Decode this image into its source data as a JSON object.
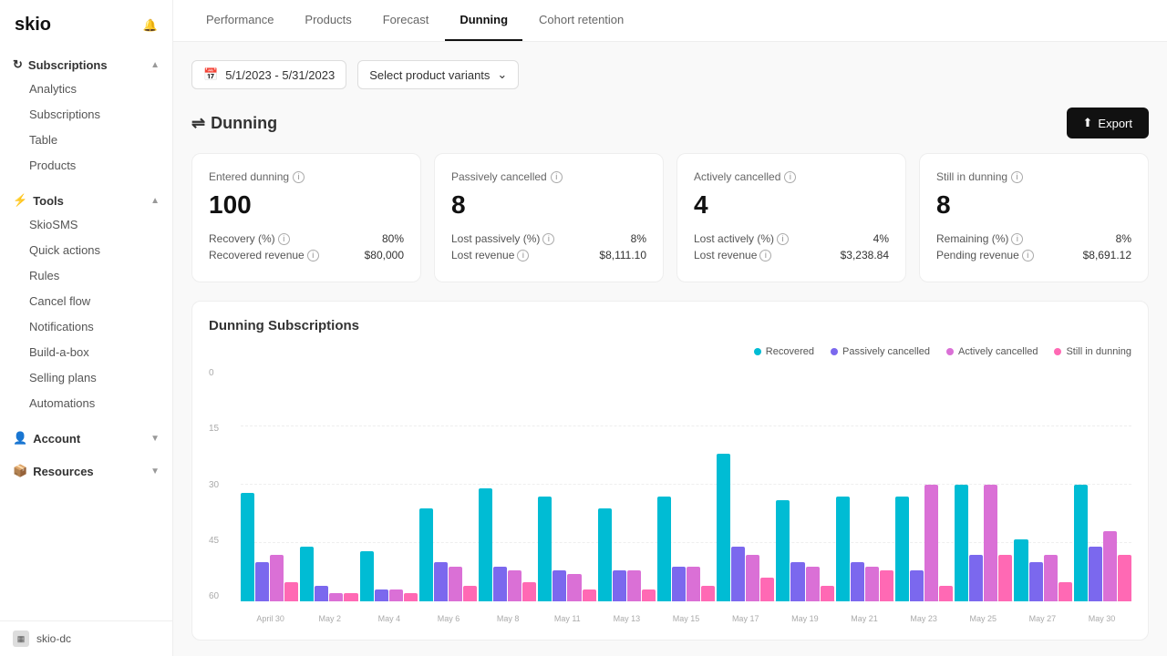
{
  "sidebar": {
    "logo": "skio",
    "sections": [
      {
        "title": "Subscriptions",
        "icon": "↻",
        "expanded": true,
        "items": [
          {
            "label": "Analytics",
            "active": false
          },
          {
            "label": "Subscriptions",
            "active": false
          },
          {
            "label": "Table",
            "active": false
          },
          {
            "label": "Products",
            "active": false
          }
        ]
      },
      {
        "title": "Tools",
        "icon": "⚡",
        "expanded": true,
        "items": [
          {
            "label": "SkioSMS",
            "active": false
          },
          {
            "label": "Quick actions",
            "active": false
          },
          {
            "label": "Rules",
            "active": false
          },
          {
            "label": "Cancel flow",
            "active": false
          },
          {
            "label": "Notifications",
            "active": false
          },
          {
            "label": "Build-a-box",
            "active": false
          },
          {
            "label": "Selling plans",
            "active": false
          },
          {
            "label": "Automations",
            "active": false
          }
        ]
      },
      {
        "title": "Account",
        "icon": "👤",
        "expanded": false,
        "items": []
      },
      {
        "title": "Resources",
        "icon": "📦",
        "expanded": false,
        "items": []
      }
    ],
    "footer_label": "skio-dc"
  },
  "tabs": [
    {
      "label": "Performance",
      "active": false
    },
    {
      "label": "Products",
      "active": false
    },
    {
      "label": "Forecast",
      "active": false
    },
    {
      "label": "Dunning",
      "active": true
    },
    {
      "label": "Cohort retention",
      "active": false
    }
  ],
  "filters": {
    "date_range": "5/1/2023 - 5/31/2023",
    "product_variants": "Select product variants"
  },
  "dunning": {
    "title": "Dunning",
    "export_label": "Export",
    "cards": [
      {
        "title": "Entered dunning",
        "value": "100",
        "rows": [
          {
            "label": "Recovery (%)",
            "value": "80%"
          },
          {
            "label": "Recovered revenue",
            "value": "$80,000"
          }
        ]
      },
      {
        "title": "Passively cancelled",
        "value": "8",
        "rows": [
          {
            "label": "Lost passively (%)",
            "value": "8%"
          },
          {
            "label": "Lost revenue",
            "value": "$8,111.10"
          }
        ]
      },
      {
        "title": "Actively cancelled",
        "value": "4",
        "rows": [
          {
            "label": "Lost actively (%)",
            "value": "4%"
          },
          {
            "label": "Lost revenue",
            "value": "$3,238.84"
          }
        ]
      },
      {
        "title": "Still in dunning",
        "value": "8",
        "rows": [
          {
            "label": "Remaining (%)",
            "value": "8%"
          },
          {
            "label": "Pending revenue",
            "value": "$8,691.12"
          }
        ]
      }
    ]
  },
  "chart": {
    "title": "Dunning Subscriptions",
    "legend": [
      {
        "label": "Recovered",
        "color": "#00BCD4"
      },
      {
        "label": "Passively cancelled",
        "color": "#7B68EE"
      },
      {
        "label": "Actively cancelled",
        "color": "#DA70D6"
      },
      {
        "label": "Still in dunning",
        "color": "#FF69B4"
      }
    ],
    "y_labels": [
      "0",
      "15",
      "30",
      "45",
      "60"
    ],
    "x_labels": [
      "April 30",
      "May 2",
      "May 4",
      "May 6",
      "May 8",
      "May 11",
      "May 13",
      "May 15",
      "May 17",
      "May 19",
      "May 21",
      "May 23",
      "May 25",
      "May 27",
      "May 30"
    ],
    "bars": [
      [
        28,
        10,
        12,
        5
      ],
      [
        14,
        4,
        2,
        2
      ],
      [
        13,
        3,
        3,
        2
      ],
      [
        24,
        10,
        9,
        4
      ],
      [
        29,
        9,
        8,
        5
      ],
      [
        27,
        8,
        7,
        3
      ],
      [
        24,
        8,
        8,
        3
      ],
      [
        27,
        9,
        9,
        4
      ],
      [
        38,
        14,
        12,
        6
      ],
      [
        26,
        10,
        9,
        4
      ],
      [
        27,
        10,
        9,
        8
      ],
      [
        27,
        8,
        30,
        4
      ],
      [
        30,
        12,
        30,
        12
      ],
      [
        16,
        10,
        12,
        5
      ],
      [
        30,
        14,
        18,
        12
      ]
    ],
    "max_value": 60
  }
}
